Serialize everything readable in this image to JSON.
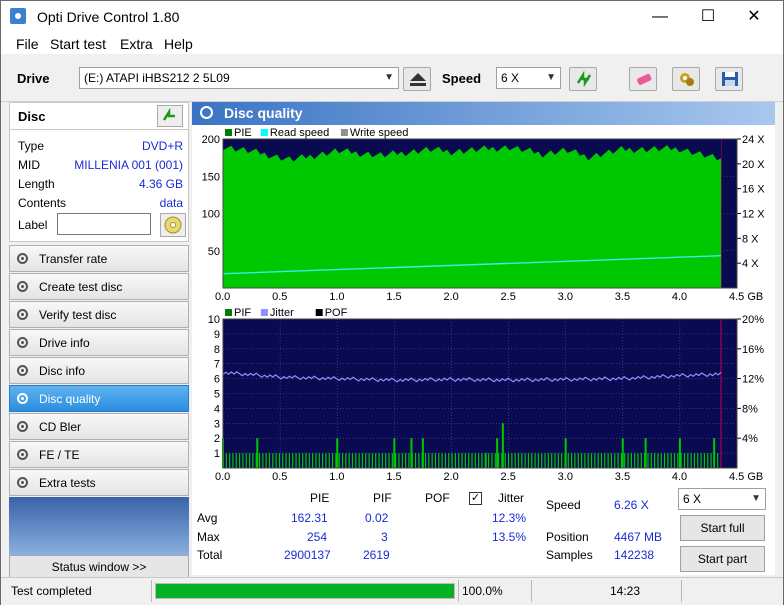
{
  "app": {
    "title": "Opti Drive Control 1.80",
    "minimize": "—",
    "maximize": "☐",
    "close": "✕"
  },
  "menu": [
    "File",
    "Start test",
    "Extra",
    "Help"
  ],
  "toolbar": {
    "drive_label": "Drive",
    "drive_value": "(E:)   ATAPI iHBS212   2 5L09",
    "speed_label": "Speed",
    "speed_value": "6 X"
  },
  "disc": {
    "header": "Disc",
    "rows": [
      {
        "key": "Type",
        "value": "DVD+R"
      },
      {
        "key": "MID",
        "value": "MILLENIA 001 (001)"
      },
      {
        "key": "Length",
        "value": "4.36 GB"
      },
      {
        "key": "Contents",
        "value": "data"
      }
    ],
    "label_key": "Label",
    "label_value": ""
  },
  "nav": [
    {
      "label": "Transfer rate",
      "active": false
    },
    {
      "label": "Create test disc",
      "active": false
    },
    {
      "label": "Verify test disc",
      "active": false
    },
    {
      "label": "Drive info",
      "active": false
    },
    {
      "label": "Disc info",
      "active": false
    },
    {
      "label": "Disc quality",
      "active": true
    },
    {
      "label": "CD Bler",
      "active": false
    },
    {
      "label": "FE / TE",
      "active": false
    },
    {
      "label": "Extra tests",
      "active": false
    }
  ],
  "status_window_button": "Status window >>",
  "panel_title": "Disc quality",
  "chart_data": [
    {
      "type": "area",
      "legend": [
        "PIE",
        "Read speed",
        "Write speed"
      ],
      "legend_colors": [
        "#008000",
        "#00ffff",
        "#909090"
      ],
      "x_ticks": [
        "0.0",
        "0.5",
        "1.0",
        "1.5",
        "2.0",
        "2.5",
        "3.0",
        "3.5",
        "4.0",
        "4.5 GB"
      ],
      "xlim": [
        0,
        4.5
      ],
      "y_ticks_left": [
        "50",
        "100",
        "150",
        "200"
      ],
      "ylim_left": [
        0,
        200
      ],
      "y_ticks_right": [
        "4 X",
        "8 X",
        "12 X",
        "16 X",
        "20 X",
        "24 X"
      ],
      "ylim_right": [
        0,
        24
      ],
      "data_end_gb": 4.36,
      "pie_fill_level": 200,
      "pie_envelope": {
        "x": [
          0.0,
          0.3,
          0.6,
          1.0,
          1.4,
          1.8,
          2.0,
          2.5,
          2.8,
          3.0,
          3.2,
          3.5,
          4.0,
          4.36
        ],
        "y": [
          190,
          182,
          172,
          184,
          178,
          186,
          183,
          189,
          180,
          185,
          176,
          186,
          187,
          172
        ]
      },
      "read_speed": {
        "x": [
          0.0,
          4.36
        ],
        "y": [
          2.3,
          5.2
        ]
      },
      "colors": {
        "background": "#0a0a50",
        "pie": "#00c800",
        "read_speed": "#40e8e8",
        "grid": "#5050a0"
      }
    },
    {
      "type": "line",
      "legend": [
        "PIF",
        "Jitter",
        "POF"
      ],
      "legend_colors": [
        "#008000",
        "#9090ff",
        "#000000"
      ],
      "x_ticks": [
        "0.0",
        "0.5",
        "1.0",
        "1.5",
        "2.0",
        "2.5",
        "3.0",
        "3.5",
        "4.0",
        "4.5 GB"
      ],
      "xlim": [
        0,
        4.5
      ],
      "y_ticks_left": [
        "1",
        "2",
        "3",
        "4",
        "5",
        "6",
        "7",
        "8",
        "9",
        "10"
      ],
      "ylim_left": [
        0,
        10
      ],
      "y_ticks_right": [
        "4%",
        "8%",
        "12%",
        "16%",
        "20%"
      ],
      "ylim_right": [
        0,
        20
      ],
      "data_end_gb": 4.36,
      "jitter": {
        "x": [
          0.0,
          0.2,
          0.5,
          1.0,
          1.5,
          2.0,
          2.5,
          3.0,
          3.5,
          4.0,
          4.36
        ],
        "y": [
          12.8,
          12.6,
          12.2,
          12.0,
          11.8,
          11.9,
          11.8,
          11.9,
          12.0,
          12.4,
          12.6
        ]
      },
      "pif_spikes": {
        "x": [
          0.0,
          0.3,
          1.0,
          1.5,
          1.65,
          1.75,
          2.3,
          2.4,
          2.45,
          3.0,
          3.5,
          3.7,
          4.0,
          4.3
        ],
        "y": [
          2,
          2,
          2,
          2,
          2,
          2,
          1,
          2,
          3,
          2,
          2,
          2,
          2,
          2
        ]
      },
      "colors": {
        "background": "#0a0a50",
        "pif": "#00c800",
        "jitter": "#9090ff",
        "grid": "#5050a0"
      }
    }
  ],
  "stats": {
    "headers": [
      "PIE",
      "PIF",
      "POF",
      "Jitter"
    ],
    "rows": [
      {
        "label": "Avg",
        "pie": "162.31",
        "pif": "0.02",
        "pof": "",
        "jitter": "12.3%"
      },
      {
        "label": "Max",
        "pie": "254",
        "pif": "3",
        "pof": "",
        "jitter": "13.5%"
      },
      {
        "label": "Total",
        "pie": "2900137",
        "pif": "2619",
        "pof": "",
        "jitter": ""
      }
    ],
    "jitter_checked": true,
    "speed_label": "Speed",
    "speed_value": "6.26 X",
    "position_label": "Position",
    "position_value": "4467 MB",
    "samples_label": "Samples",
    "samples_value": "142238",
    "speed_select": "6 X",
    "start_full": "Start full",
    "start_part": "Start part"
  },
  "statusbar": {
    "text": "Test completed",
    "progress": 1.0,
    "progress_text": "100.0%",
    "time": "14:23"
  }
}
